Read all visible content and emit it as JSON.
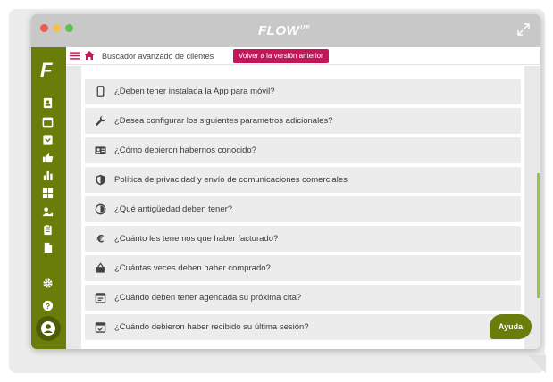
{
  "window": {
    "brand": "FLOW",
    "brand_suffix": "UP"
  },
  "sidebar": {
    "logo": "F",
    "icons": [
      "contact-card-icon",
      "calendar-icon",
      "inbox-icon",
      "thumbs-up-icon",
      "bar-chart-icon",
      "grid-icon",
      "user-hand-icon",
      "clipboard-icon",
      "document-icon",
      "gear-icon",
      "help-icon",
      "user-avatar-icon"
    ]
  },
  "topbar": {
    "title": "Buscador avanzado de clientes",
    "back_button": "Volver a la versión anterior"
  },
  "questions": [
    {
      "label": "¿Deben tener instalada la App para móvil?",
      "icon": "phone-icon"
    },
    {
      "label": "¿Desea configurar los siguientes parametros adicionales?",
      "icon": "wrench-icon"
    },
    {
      "label": "¿Cómo debieron habernos conocido?",
      "icon": "id-card-icon"
    },
    {
      "label": "Política de privacidad y envío de comunicaciones comerciales",
      "icon": "shield-icon"
    },
    {
      "label": "¿Qué antigüedad deben tener?",
      "icon": "half-circle-icon"
    },
    {
      "label": "¿Cuánto les tenemos que haber facturado?",
      "icon": "euro-icon"
    },
    {
      "label": "¿Cuántas veces deben haber comprado?",
      "icon": "basket-icon"
    },
    {
      "label": "¿Cuándo deben tener agendada su próxima cita?",
      "icon": "calendar-event-icon"
    },
    {
      "label": "¿Cuándo debieron haber recibido su última sesión?",
      "icon": "calendar-check-icon"
    }
  ],
  "help_button": "Ayuda",
  "colors": {
    "sidebar": "#6a7d0a",
    "accent_button": "#c2185b",
    "row_bg": "#ececec",
    "scroll_accent": "#93c840"
  }
}
